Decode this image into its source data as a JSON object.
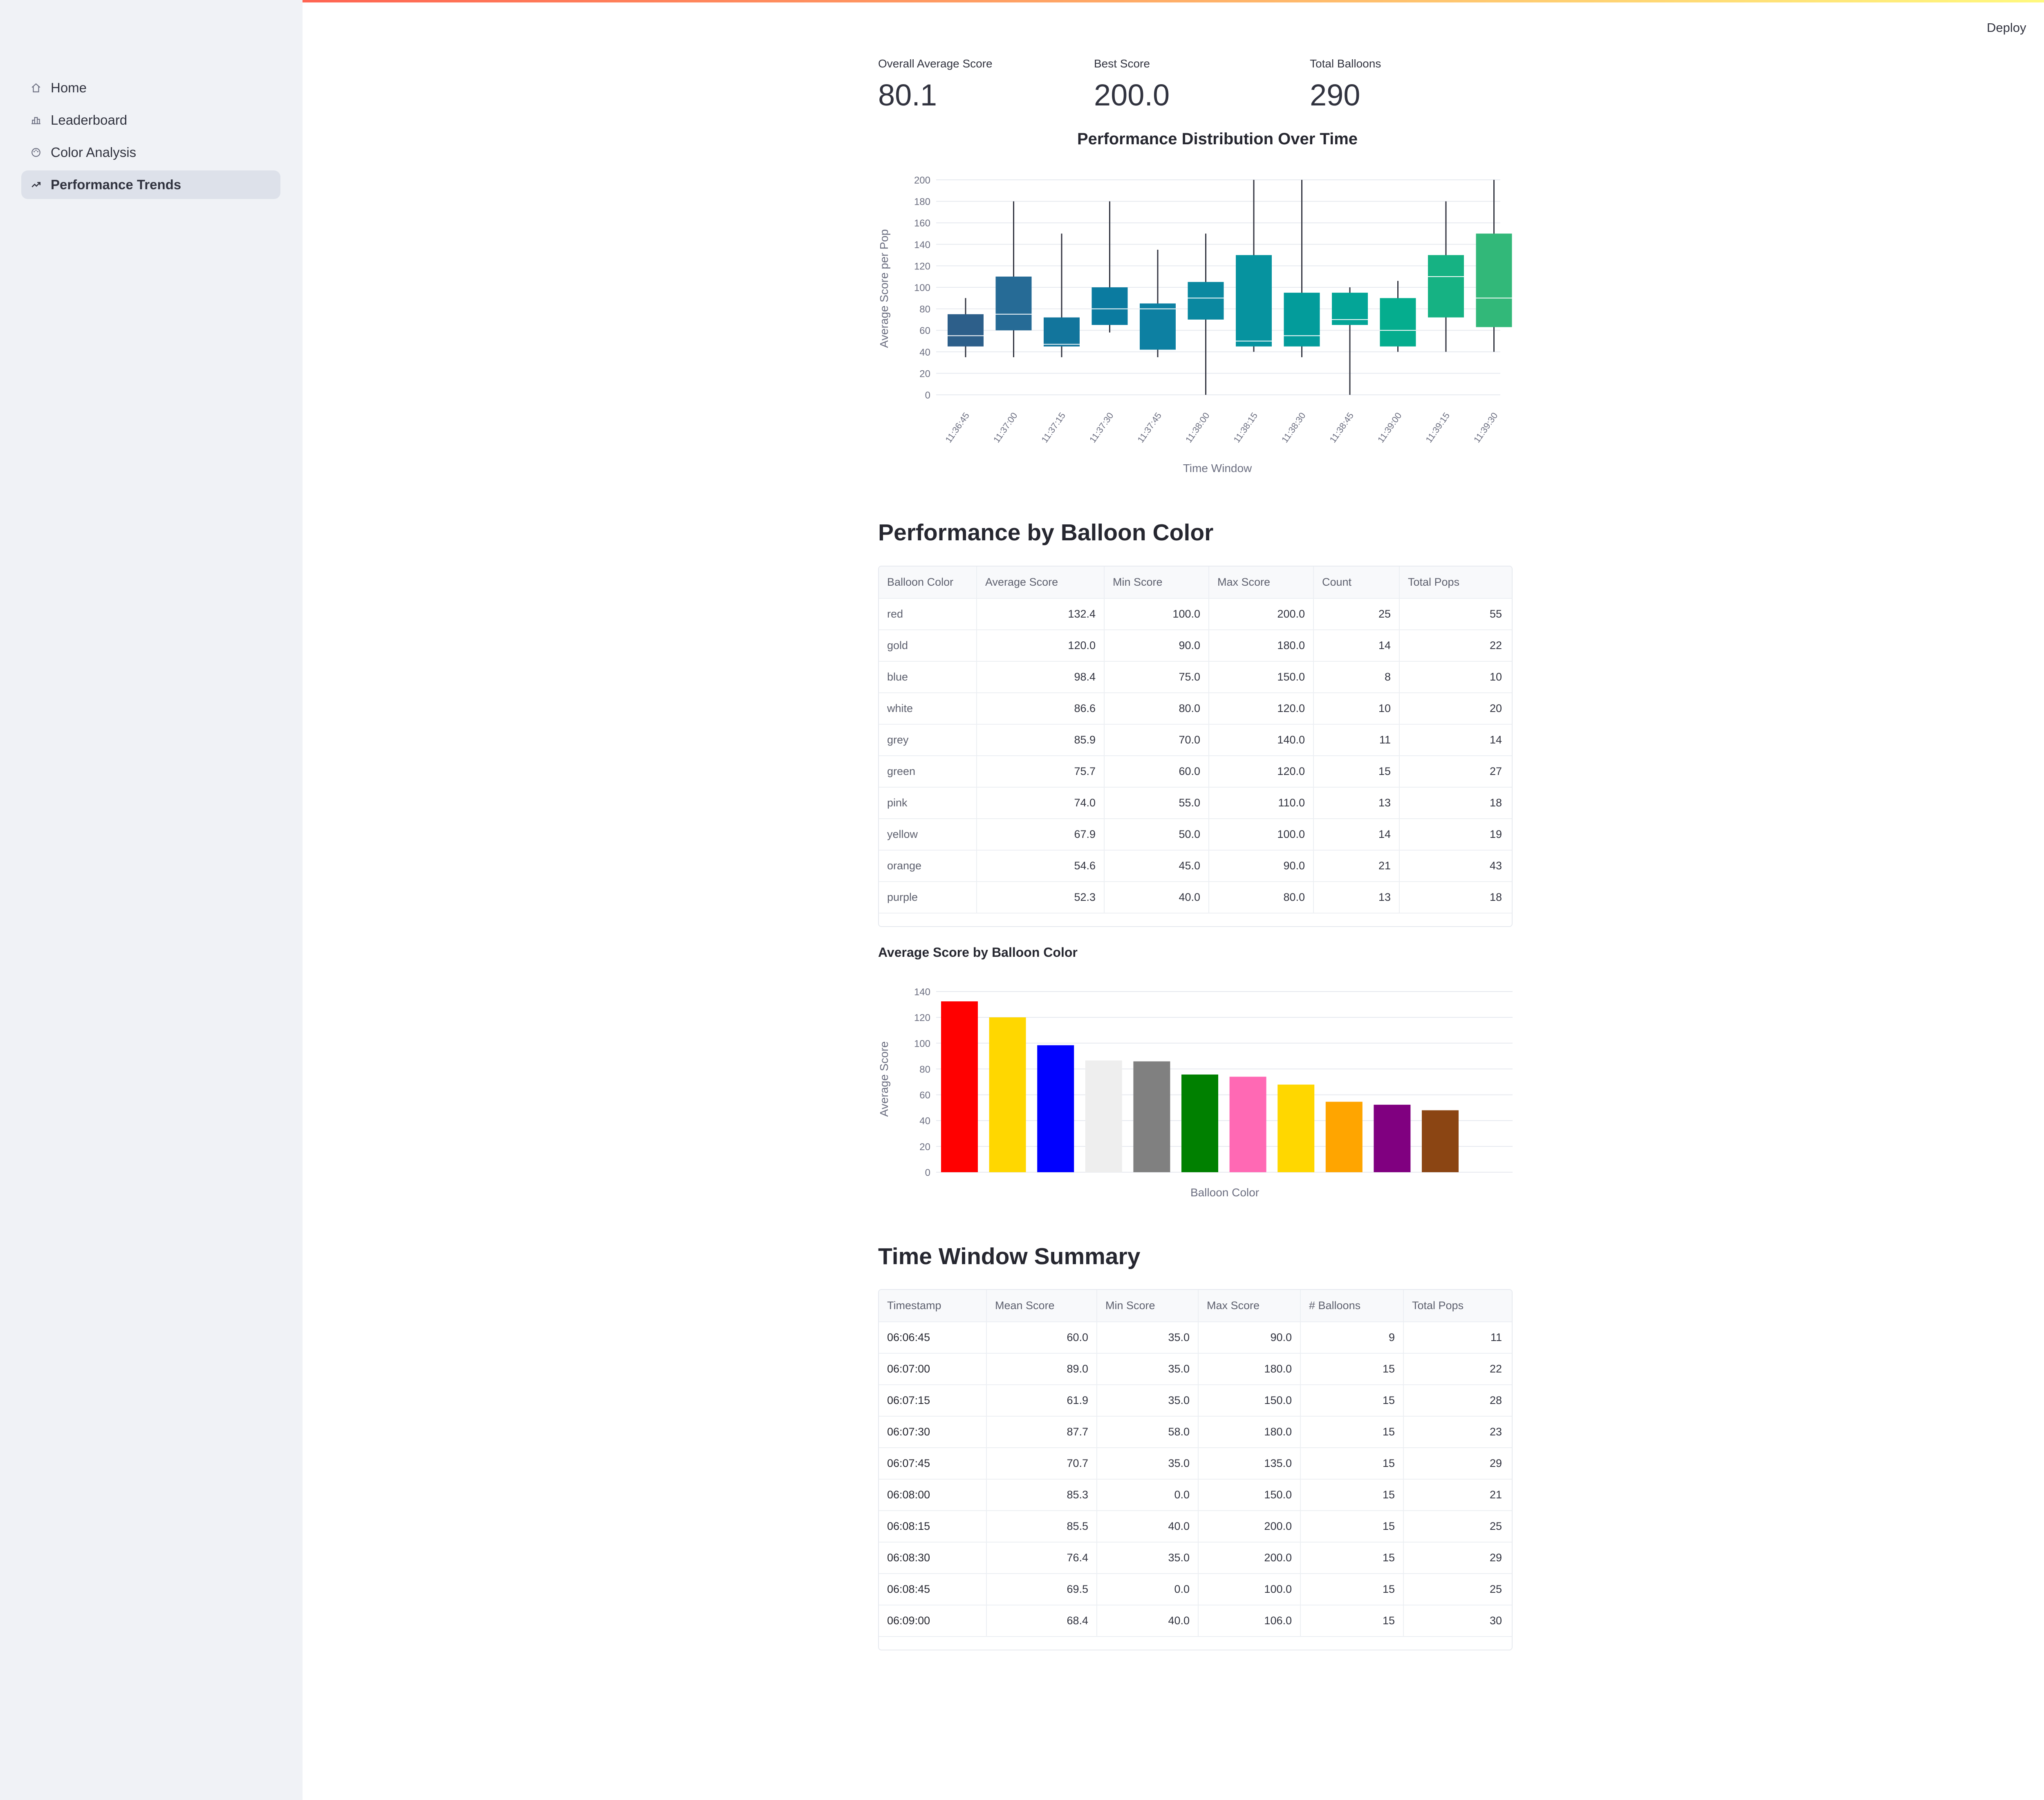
{
  "sidebar": {
    "items": [
      {
        "label": "Home",
        "icon": "home-icon",
        "active": false
      },
      {
        "label": "Leaderboard",
        "icon": "bar-chart-icon",
        "active": false
      },
      {
        "label": "Color Analysis",
        "icon": "palette-icon",
        "active": false
      },
      {
        "label": "Performance Trends",
        "icon": "trending-up-icon",
        "active": true
      }
    ]
  },
  "header": {
    "deploy_label": "Deploy"
  },
  "metrics": [
    {
      "label": "Overall Average Score",
      "value": "80.1"
    },
    {
      "label": "Best Score",
      "value": "200.0"
    },
    {
      "label": "Total Balloons",
      "value": "290"
    }
  ],
  "box_chart": {
    "title": "Performance Distribution Over Time",
    "xlabel": "Time Window",
    "ylabel": "Average Score per Pop"
  },
  "color_table": {
    "title": "Performance by Balloon Color",
    "columns": [
      "Balloon Color",
      "Average Score",
      "Min Score",
      "Max Score",
      "Count",
      "Total Pops"
    ],
    "rows": [
      [
        "red",
        "132.4",
        "100.0",
        "200.0",
        "25",
        "55"
      ],
      [
        "gold",
        "120.0",
        "90.0",
        "180.0",
        "14",
        "22"
      ],
      [
        "blue",
        "98.4",
        "75.0",
        "150.0",
        "8",
        "10"
      ],
      [
        "white",
        "86.6",
        "80.0",
        "120.0",
        "10",
        "20"
      ],
      [
        "grey",
        "85.9",
        "70.0",
        "140.0",
        "11",
        "14"
      ],
      [
        "green",
        "75.7",
        "60.0",
        "120.0",
        "15",
        "27"
      ],
      [
        "pink",
        "74.0",
        "55.0",
        "110.0",
        "13",
        "18"
      ],
      [
        "yellow",
        "67.9",
        "50.0",
        "100.0",
        "14",
        "19"
      ],
      [
        "orange",
        "54.6",
        "45.0",
        "90.0",
        "21",
        "43"
      ],
      [
        "purple",
        "52.3",
        "40.0",
        "80.0",
        "13",
        "18"
      ]
    ]
  },
  "bar_chart": {
    "title": "Average Score by Balloon Color",
    "xlabel": "Balloon Color",
    "ylabel": "Average Score"
  },
  "time_table": {
    "title": "Time Window Summary",
    "columns": [
      "Timestamp",
      "Mean Score",
      "Min Score",
      "Max Score",
      "# Balloons",
      "Total Pops"
    ],
    "rows": [
      [
        "06:06:45",
        "60.0",
        "35.0",
        "90.0",
        "9",
        "11"
      ],
      [
        "06:07:00",
        "89.0",
        "35.0",
        "180.0",
        "15",
        "22"
      ],
      [
        "06:07:15",
        "61.9",
        "35.0",
        "150.0",
        "15",
        "28"
      ],
      [
        "06:07:30",
        "87.7",
        "58.0",
        "180.0",
        "15",
        "23"
      ],
      [
        "06:07:45",
        "70.7",
        "35.0",
        "135.0",
        "15",
        "29"
      ],
      [
        "06:08:00",
        "85.3",
        "0.0",
        "150.0",
        "15",
        "21"
      ],
      [
        "06:08:15",
        "85.5",
        "40.0",
        "200.0",
        "15",
        "25"
      ],
      [
        "06:08:30",
        "76.4",
        "35.0",
        "200.0",
        "15",
        "29"
      ],
      [
        "06:08:45",
        "69.5",
        "0.0",
        "100.0",
        "15",
        "25"
      ],
      [
        "06:09:00",
        "68.4",
        "40.0",
        "106.0",
        "15",
        "30"
      ]
    ]
  },
  "chart_data": [
    {
      "type": "box",
      "title": "Performance Distribution Over Time",
      "xlabel": "Time Window",
      "ylabel": "Average Score per Pop",
      "ylim": [
        0,
        200
      ],
      "yticks": [
        0,
        20,
        40,
        60,
        80,
        100,
        120,
        140,
        160,
        180,
        200
      ],
      "grid": true,
      "categories": [
        "11:36:45",
        "11:37:00",
        "11:37:15",
        "11:37:30",
        "11:37:45",
        "11:38:00",
        "11:38:15",
        "11:38:30",
        "11:38:45",
        "11:39:00",
        "11:39:15",
        "11:39:30"
      ],
      "boxes": [
        {
          "min": 35,
          "q1": 45,
          "median": 55,
          "q3": 75,
          "max": 90,
          "color": "#2d5f8a"
        },
        {
          "min": 35,
          "q1": 60,
          "median": 75,
          "q3": 110,
          "max": 180,
          "color": "#266b96"
        },
        {
          "min": 35,
          "q1": 45,
          "median": 47,
          "q3": 72,
          "max": 150,
          "color": "#12759c"
        },
        {
          "min": 58,
          "q1": 65,
          "median": 80,
          "q3": 100,
          "max": 180,
          "color": "#0b7ba0"
        },
        {
          "min": 35,
          "q1": 42,
          "median": 80,
          "q3": 85,
          "max": 135,
          "color": "#0d80a2"
        },
        {
          "min": 0,
          "q1": 70,
          "median": 90,
          "q3": 105,
          "max": 150,
          "color": "#0a88a0"
        },
        {
          "min": 40,
          "q1": 45,
          "median": 50,
          "q3": 130,
          "max": 200,
          "color": "#06939f"
        },
        {
          "min": 35,
          "q1": 45,
          "median": 55,
          "q3": 95,
          "max": 200,
          "color": "#039c9b"
        },
        {
          "min": 0,
          "q1": 65,
          "median": 70,
          "q3": 95,
          "max": 100,
          "color": "#04a597"
        },
        {
          "min": 40,
          "q1": 45,
          "median": 60,
          "q3": 90,
          "max": 106,
          "color": "#05ad8e"
        },
        {
          "min": 40,
          "q1": 72,
          "median": 110,
          "q3": 130,
          "max": 180,
          "color": "#16b283"
        },
        {
          "min": 40,
          "q1": 63,
          "median": 90,
          "q3": 150,
          "max": 200,
          "color": "#32b879"
        }
      ]
    },
    {
      "type": "bar",
      "title": "Average Score by Balloon Color",
      "xlabel": "Balloon Color",
      "ylabel": "Average Score",
      "ylim": [
        0,
        140
      ],
      "yticks": [
        0,
        20,
        40,
        60,
        80,
        100,
        120,
        140
      ],
      "grid": true,
      "categories": [
        "red",
        "gold",
        "blue",
        "white",
        "grey",
        "green",
        "pink",
        "yellow",
        "orange",
        "purple",
        "brown"
      ],
      "values": [
        132.4,
        120.0,
        98.4,
        86.6,
        85.9,
        75.7,
        74.0,
        67.9,
        54.6,
        52.3,
        48.0
      ],
      "colors": [
        "#ff0000",
        "#ffd700",
        "#0000ff",
        "#eeeeee",
        "#808080",
        "#008000",
        "#ff69b4",
        "#ffd700",
        "#ffa500",
        "#800080",
        "#8b4513"
      ]
    }
  ]
}
